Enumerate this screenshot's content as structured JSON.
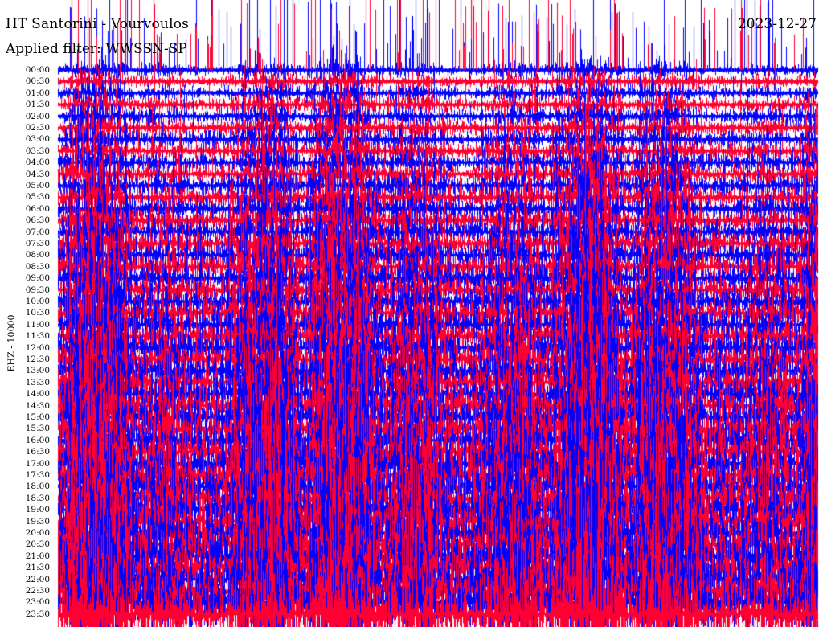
{
  "header": {
    "station": "HT Santorini - Vourvoulos",
    "date": "2023-12-27",
    "filter": "Applied filter: WWSSN-SP"
  },
  "chart_data": {
    "type": "line",
    "title": "HT Santorini - Vourvoulos",
    "date": "2023-12-27",
    "filter": "Applied filter: WWSSN-SP",
    "ylabel": "EHZ - 10000",
    "y_tick_labels": [
      "00:00",
      "00:30",
      "01:00",
      "01:30",
      "02:00",
      "02:30",
      "03:00",
      "03:30",
      "04:00",
      "04:30",
      "05:00",
      "05:30",
      "06:00",
      "06:30",
      "07:00",
      "07:30",
      "08:00",
      "08:30",
      "09:00",
      "09:30",
      "10:00",
      "10:30",
      "11:00",
      "11:30",
      "12:00",
      "12:30",
      "13:00",
      "13:30",
      "14:00",
      "14:30",
      "15:00",
      "15:30",
      "16:00",
      "16:30",
      "17:00",
      "17:30",
      "18:00",
      "18:30",
      "19:00",
      "19:30",
      "20:00",
      "20:30",
      "21:00",
      "21:30",
      "22:00",
      "22:30",
      "23:00",
      "23:30"
    ],
    "trace_colors": [
      "#0000ff",
      "#ff0033"
    ],
    "traces_per_row": "alternating blue/red by half-hour",
    "grid": false,
    "description": "Helicorder: 48 half-hour traces of seismic amplitude, strongly saturated"
  },
  "colors": {
    "blue": "#0000ff",
    "red": "#ff0033",
    "background": "#ffffff",
    "text": "#000000"
  }
}
